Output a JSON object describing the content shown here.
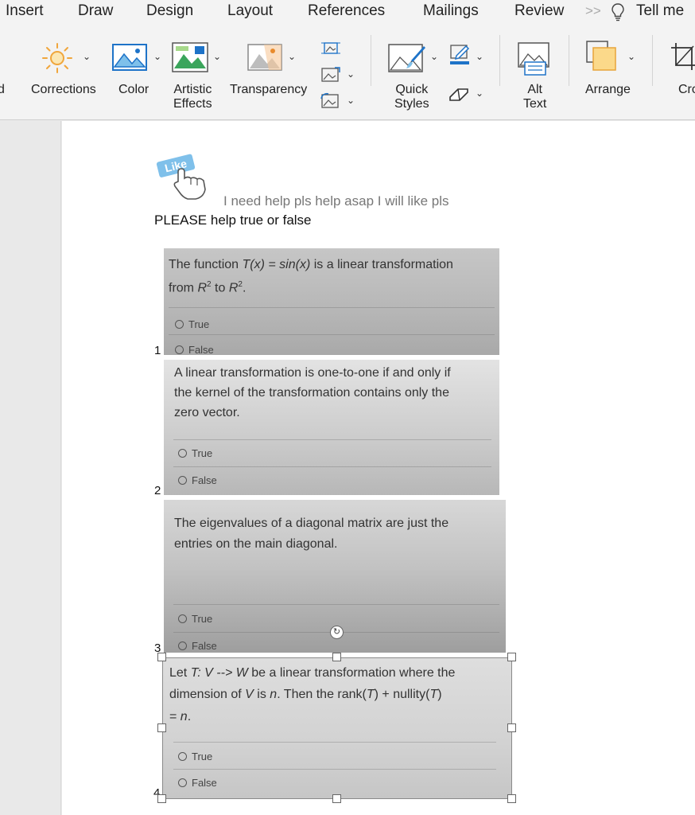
{
  "tabs": [
    "Insert",
    "Draw",
    "Design",
    "Layout",
    "References",
    "Mailings",
    "Review"
  ],
  "tabs_more": ">>",
  "tell_me": "Tell me",
  "ribbon": {
    "left_cut": "d",
    "corrections": "Corrections",
    "color": "Color",
    "artistic_1": "Artistic",
    "artistic_2": "Effects",
    "transparency": "Transparency",
    "quick_1": "Quick",
    "quick_2": "Styles",
    "alt_1": "Alt",
    "alt_2": "Text",
    "arrange": "Arrange",
    "crop_cut": "Cro"
  },
  "document": {
    "sticker_text": "Like",
    "help_line": "I need help pls help asap I will like pls",
    "please_line": "PLEASE help true or false",
    "option_true": "True",
    "option_false": "False",
    "q1": {
      "num": "1",
      "line1_a": "The function ",
      "line1_b": "T(x) = sin(x)",
      "line1_c": " is a linear transformation",
      "line2_a": "from ",
      "line2_b": "R",
      "line2_c": "2",
      "line2_d": " to ",
      "line2_e": "R",
      "line2_f": "2",
      "line2_g": "."
    },
    "q2": {
      "num": "2",
      "line1": "A linear transformation is one-to-one if and only if",
      "line2": "the kernel of the transformation contains only the",
      "line3": "zero vector."
    },
    "q3": {
      "num": "3",
      "line1": "The eigenvalues of a diagonal matrix are just the",
      "line2": "entries on the main diagonal."
    },
    "q4": {
      "num": "4",
      "line1_a": "Let ",
      "line1_b": "T: V --> W",
      "line1_c": " be a linear transformation where the",
      "line2_a": "dimension of ",
      "line2_b": "V",
      "line2_c": " is ",
      "line2_d": "n",
      "line2_e": ". Then the rank(",
      "line2_f": "T",
      "line2_g": ") + nullity(",
      "line2_h": "T",
      "line2_i": ")",
      "line3_a": "= ",
      "line3_b": "n",
      "line3_c": "."
    }
  },
  "colors": {
    "accent": "#1e73c8",
    "sticker_blue": "#7fc0ea",
    "page": "#ffffff",
    "ribbon": "#f3f3f3"
  }
}
